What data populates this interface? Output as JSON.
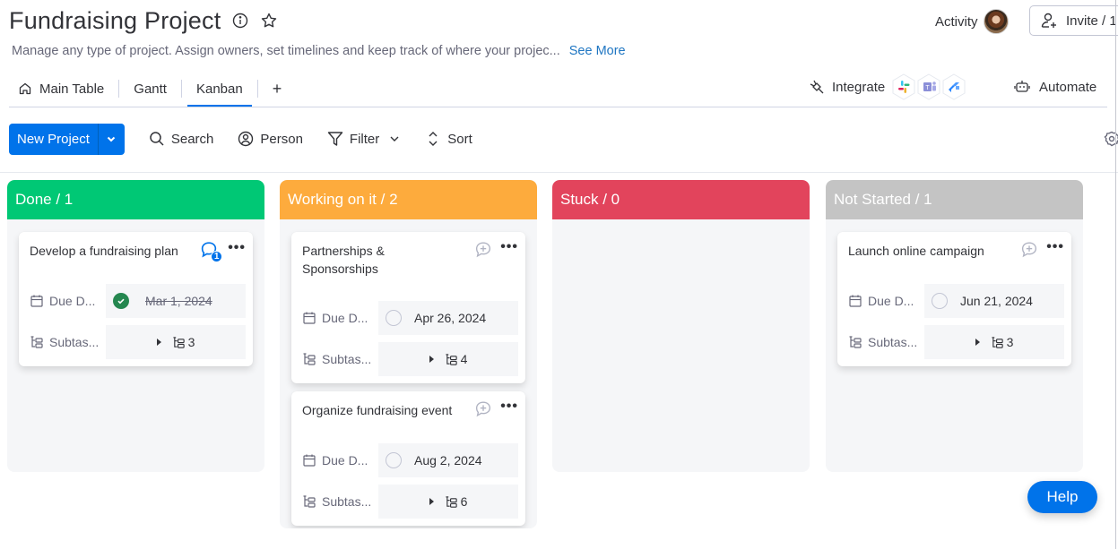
{
  "header": {
    "title": "Fundraising Project",
    "description": "Manage any type of project. Assign owners, set timelines and keep track of where your projec...",
    "see_more": "See More",
    "activity_label": "Activity",
    "invite_label": "Invite / 1"
  },
  "tabs": [
    {
      "label": "Main Table",
      "icon": "home-icon",
      "active": false
    },
    {
      "label": "Gantt",
      "active": false
    },
    {
      "label": "Kanban",
      "active": true
    },
    {
      "label": "+",
      "icon": "add-view-icon"
    }
  ],
  "integrations": {
    "integrate_label": "Integrate",
    "apps": [
      "slack",
      "teams",
      "jira"
    ],
    "automate_label": "Automate"
  },
  "toolbar": {
    "new_label": "New Project",
    "search_label": "Search",
    "person_label": "Person",
    "filter_label": "Filter",
    "sort_label": "Sort"
  },
  "columns": [
    {
      "title": "Done / 1",
      "color": "#00c875",
      "cards": [
        {
          "name": "Develop a fundraising plan",
          "updates": "1",
          "due_label": "Due D...",
          "due": "Mar 1, 2024",
          "done": true,
          "subtasks_label": "Subtas...",
          "subtasks": "3"
        }
      ]
    },
    {
      "title": "Working on it / 2",
      "color": "#fdab3d",
      "cards": [
        {
          "name": "Partnerships & Sponsorships",
          "due_label": "Due D...",
          "due": "Apr 26, 2024",
          "done": false,
          "subtasks_label": "Subtas...",
          "subtasks": "4"
        },
        {
          "name": "Organize fundraising event",
          "due_label": "Due D...",
          "due": "Aug 2, 2024",
          "done": false,
          "subtasks_label": "Subtas...",
          "subtasks": "6"
        }
      ]
    },
    {
      "title": "Stuck / 0",
      "color": "#e2445c",
      "cards": []
    },
    {
      "title": "Not Started / 1",
      "color": "#c4c4c4",
      "cards": [
        {
          "name": "Launch online campaign",
          "due_label": "Due D...",
          "due": "Jun 21, 2024",
          "done": false,
          "subtasks_label": "Subtas...",
          "subtasks": "3"
        }
      ]
    }
  ],
  "help_label": "Help"
}
